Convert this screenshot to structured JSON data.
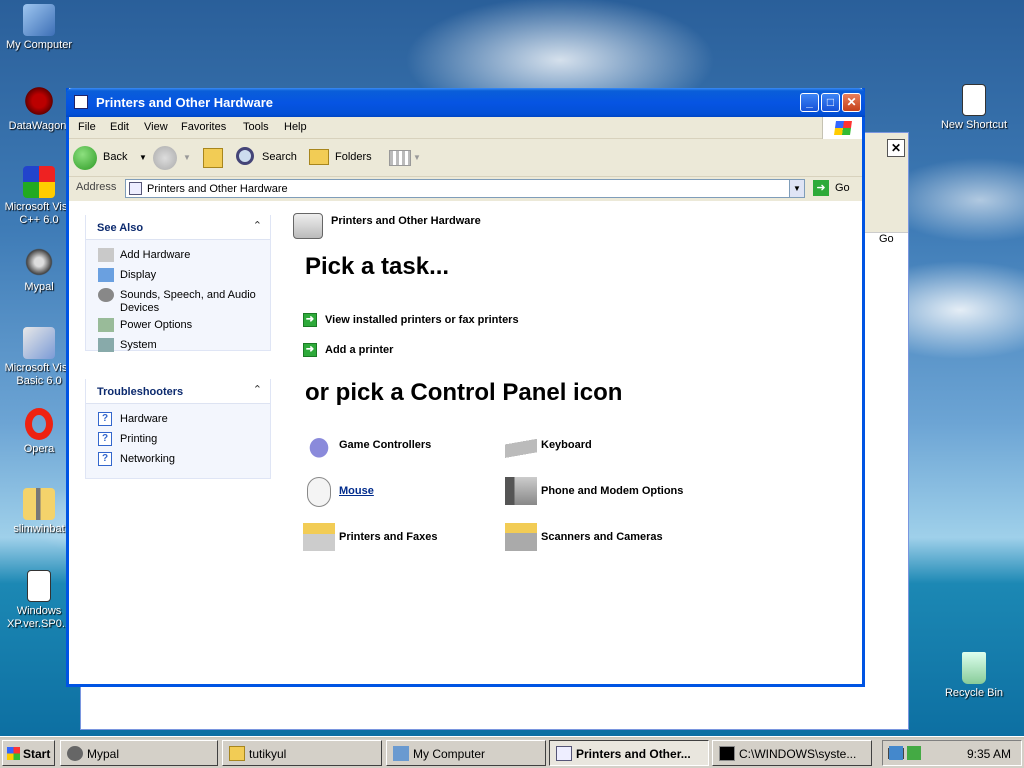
{
  "desktop": {
    "icons": [
      {
        "label": "My Computer"
      },
      {
        "label": "DataWagon."
      },
      {
        "label": "Microsoft Visu C++ 6.0"
      },
      {
        "label": "Mypal"
      },
      {
        "label": "Microsoft Visu Basic 6.0"
      },
      {
        "label": "Opera"
      },
      {
        "label": "slimwinbat"
      },
      {
        "label": "Windows XP.ver.SP0..."
      },
      {
        "label": "New Shortcut"
      },
      {
        "label": "Recycle Bin"
      }
    ]
  },
  "window": {
    "title": "Printers and Other Hardware",
    "menu": [
      "File",
      "Edit",
      "View",
      "Favorites",
      "Tools",
      "Help"
    ],
    "toolbar": {
      "back": "Back",
      "search": "Search",
      "folders": "Folders"
    },
    "address": {
      "label": "Address",
      "value": "Printers and Other Hardware",
      "go": "Go"
    },
    "see_also": {
      "title": "See Also",
      "items": [
        "Add Hardware",
        "Display",
        "Sounds, Speech, and Audio Devices",
        "Power Options",
        "System"
      ]
    },
    "troubleshooters": {
      "title": "Troubleshooters",
      "items": [
        "Hardware",
        "Printing",
        "Networking"
      ]
    },
    "category_title": "Printers and Other Hardware",
    "pick_task": "Pick a task...",
    "tasks": [
      "View installed printers or fax printers",
      "Add a printer"
    ],
    "pick_icon": "or pick a Control Panel icon",
    "icons": [
      "Game Controllers",
      "Keyboard",
      "Mouse",
      "Phone and Modem Options",
      "Printers and Faxes",
      "Scanners and Cameras"
    ]
  },
  "background_window": {
    "go": "Go"
  },
  "taskbar": {
    "start": "Start",
    "buttons": [
      "Mypal",
      "tutikyul",
      "My Computer",
      "Printers and Other...",
      "C:\\WINDOWS\\syste..."
    ],
    "clock": "9:35 AM"
  }
}
